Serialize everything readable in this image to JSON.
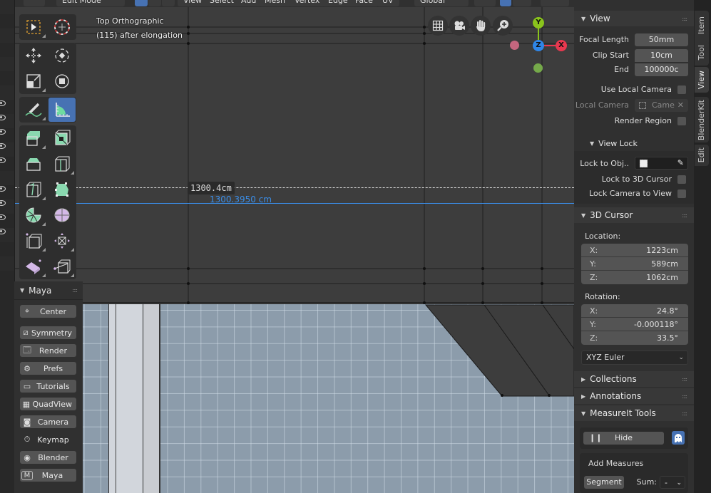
{
  "header": {
    "mode": "Edit Mode",
    "menus": [
      "View",
      "Select",
      "Add",
      "Mesh",
      "Vertex",
      "Edge",
      "Face",
      "UV"
    ],
    "orientation": "Global"
  },
  "viewport": {
    "view_name": "Top Orthographic",
    "object_info": "(115) after elongation",
    "measure_dim": "1300.4cm",
    "measure_segment": "1300.3950 cm",
    "gizmo_axes": {
      "x": "X",
      "y": "Y",
      "z": "Z"
    },
    "nav_icons": [
      "grid-icon",
      "camera-icon",
      "hand-icon",
      "zoom-icon"
    ]
  },
  "toolbar": {
    "tools": [
      "select-box",
      "cursor",
      "move",
      "rotate",
      "scale",
      "transform",
      "annotate",
      "measure",
      "extrude-region",
      "inset-faces",
      "bevel",
      "loop-cut",
      "knife",
      "poly-build",
      "spin",
      "smooth",
      "edge-slide",
      "shrink-fatten",
      "shear",
      "rip-region"
    ],
    "active_tool": "measure"
  },
  "maya_panel": {
    "title": "Maya",
    "buttons": [
      {
        "label": "Center",
        "icon": "center-icon"
      },
      {
        "label": "Symmetry",
        "icon": "symmetry-icon"
      },
      {
        "label": "Render",
        "icon": "render-icon"
      },
      {
        "label": "Prefs",
        "icon": "gear-icon"
      },
      {
        "label": "Tutorials",
        "icon": "monitor-icon"
      },
      {
        "label": "QuadView",
        "icon": "quadview-icon"
      },
      {
        "label": "Camera",
        "icon": "camera-icon"
      },
      {
        "label": "Keymap",
        "icon": "stopwatch-icon"
      },
      {
        "label": "Blender",
        "icon": "blender-icon"
      },
      {
        "label": "Maya",
        "icon": "maya-icon"
      }
    ]
  },
  "npanel": {
    "tabs": [
      "Item",
      "Tool",
      "View",
      "BlenderKit",
      "Edit"
    ],
    "active_tab": "View",
    "view": {
      "title": "View",
      "focal_length_label": "Focal Length",
      "focal_length": "50mm",
      "clip_start_label": "Clip Start",
      "clip_start": "10cm",
      "clip_end_label": "End",
      "clip_end": "100000c",
      "use_local_camera_label": "Use Local Camera",
      "use_local_camera": false,
      "local_camera_label": "Local Camera",
      "local_camera_value": "Came",
      "render_region_label": "Render Region",
      "render_region": false
    },
    "view_lock": {
      "title": "View Lock",
      "lock_to_obj_label": "Lock to Obj..",
      "lock_to_cursor_label": "Lock to 3D Cursor",
      "lock_to_cursor": false,
      "lock_camera_label": "Lock Camera to View",
      "lock_camera": false
    },
    "cursor": {
      "title": "3D Cursor",
      "location_label": "Location:",
      "location": [
        {
          "axis": "X:",
          "value": "1223cm"
        },
        {
          "axis": "Y:",
          "value": "589cm"
        },
        {
          "axis": "Z:",
          "value": "1062cm"
        }
      ],
      "rotation_label": "Rotation:",
      "rotation": [
        {
          "axis": "X:",
          "value": "24.8°"
        },
        {
          "axis": "Y:",
          "value": "-0.000118°"
        },
        {
          "axis": "Z:",
          "value": "33.5°"
        }
      ],
      "rotation_mode": "XYZ Euler"
    },
    "collections": {
      "title": "Collections"
    },
    "annotations": {
      "title": "Annotations"
    },
    "measureit": {
      "title": "MeasureIt Tools",
      "hide_label": "Hide",
      "add_measures_label": "Add Measures",
      "segment_label": "Segment",
      "sum_label": "Sum:",
      "sum_value": "-"
    }
  }
}
